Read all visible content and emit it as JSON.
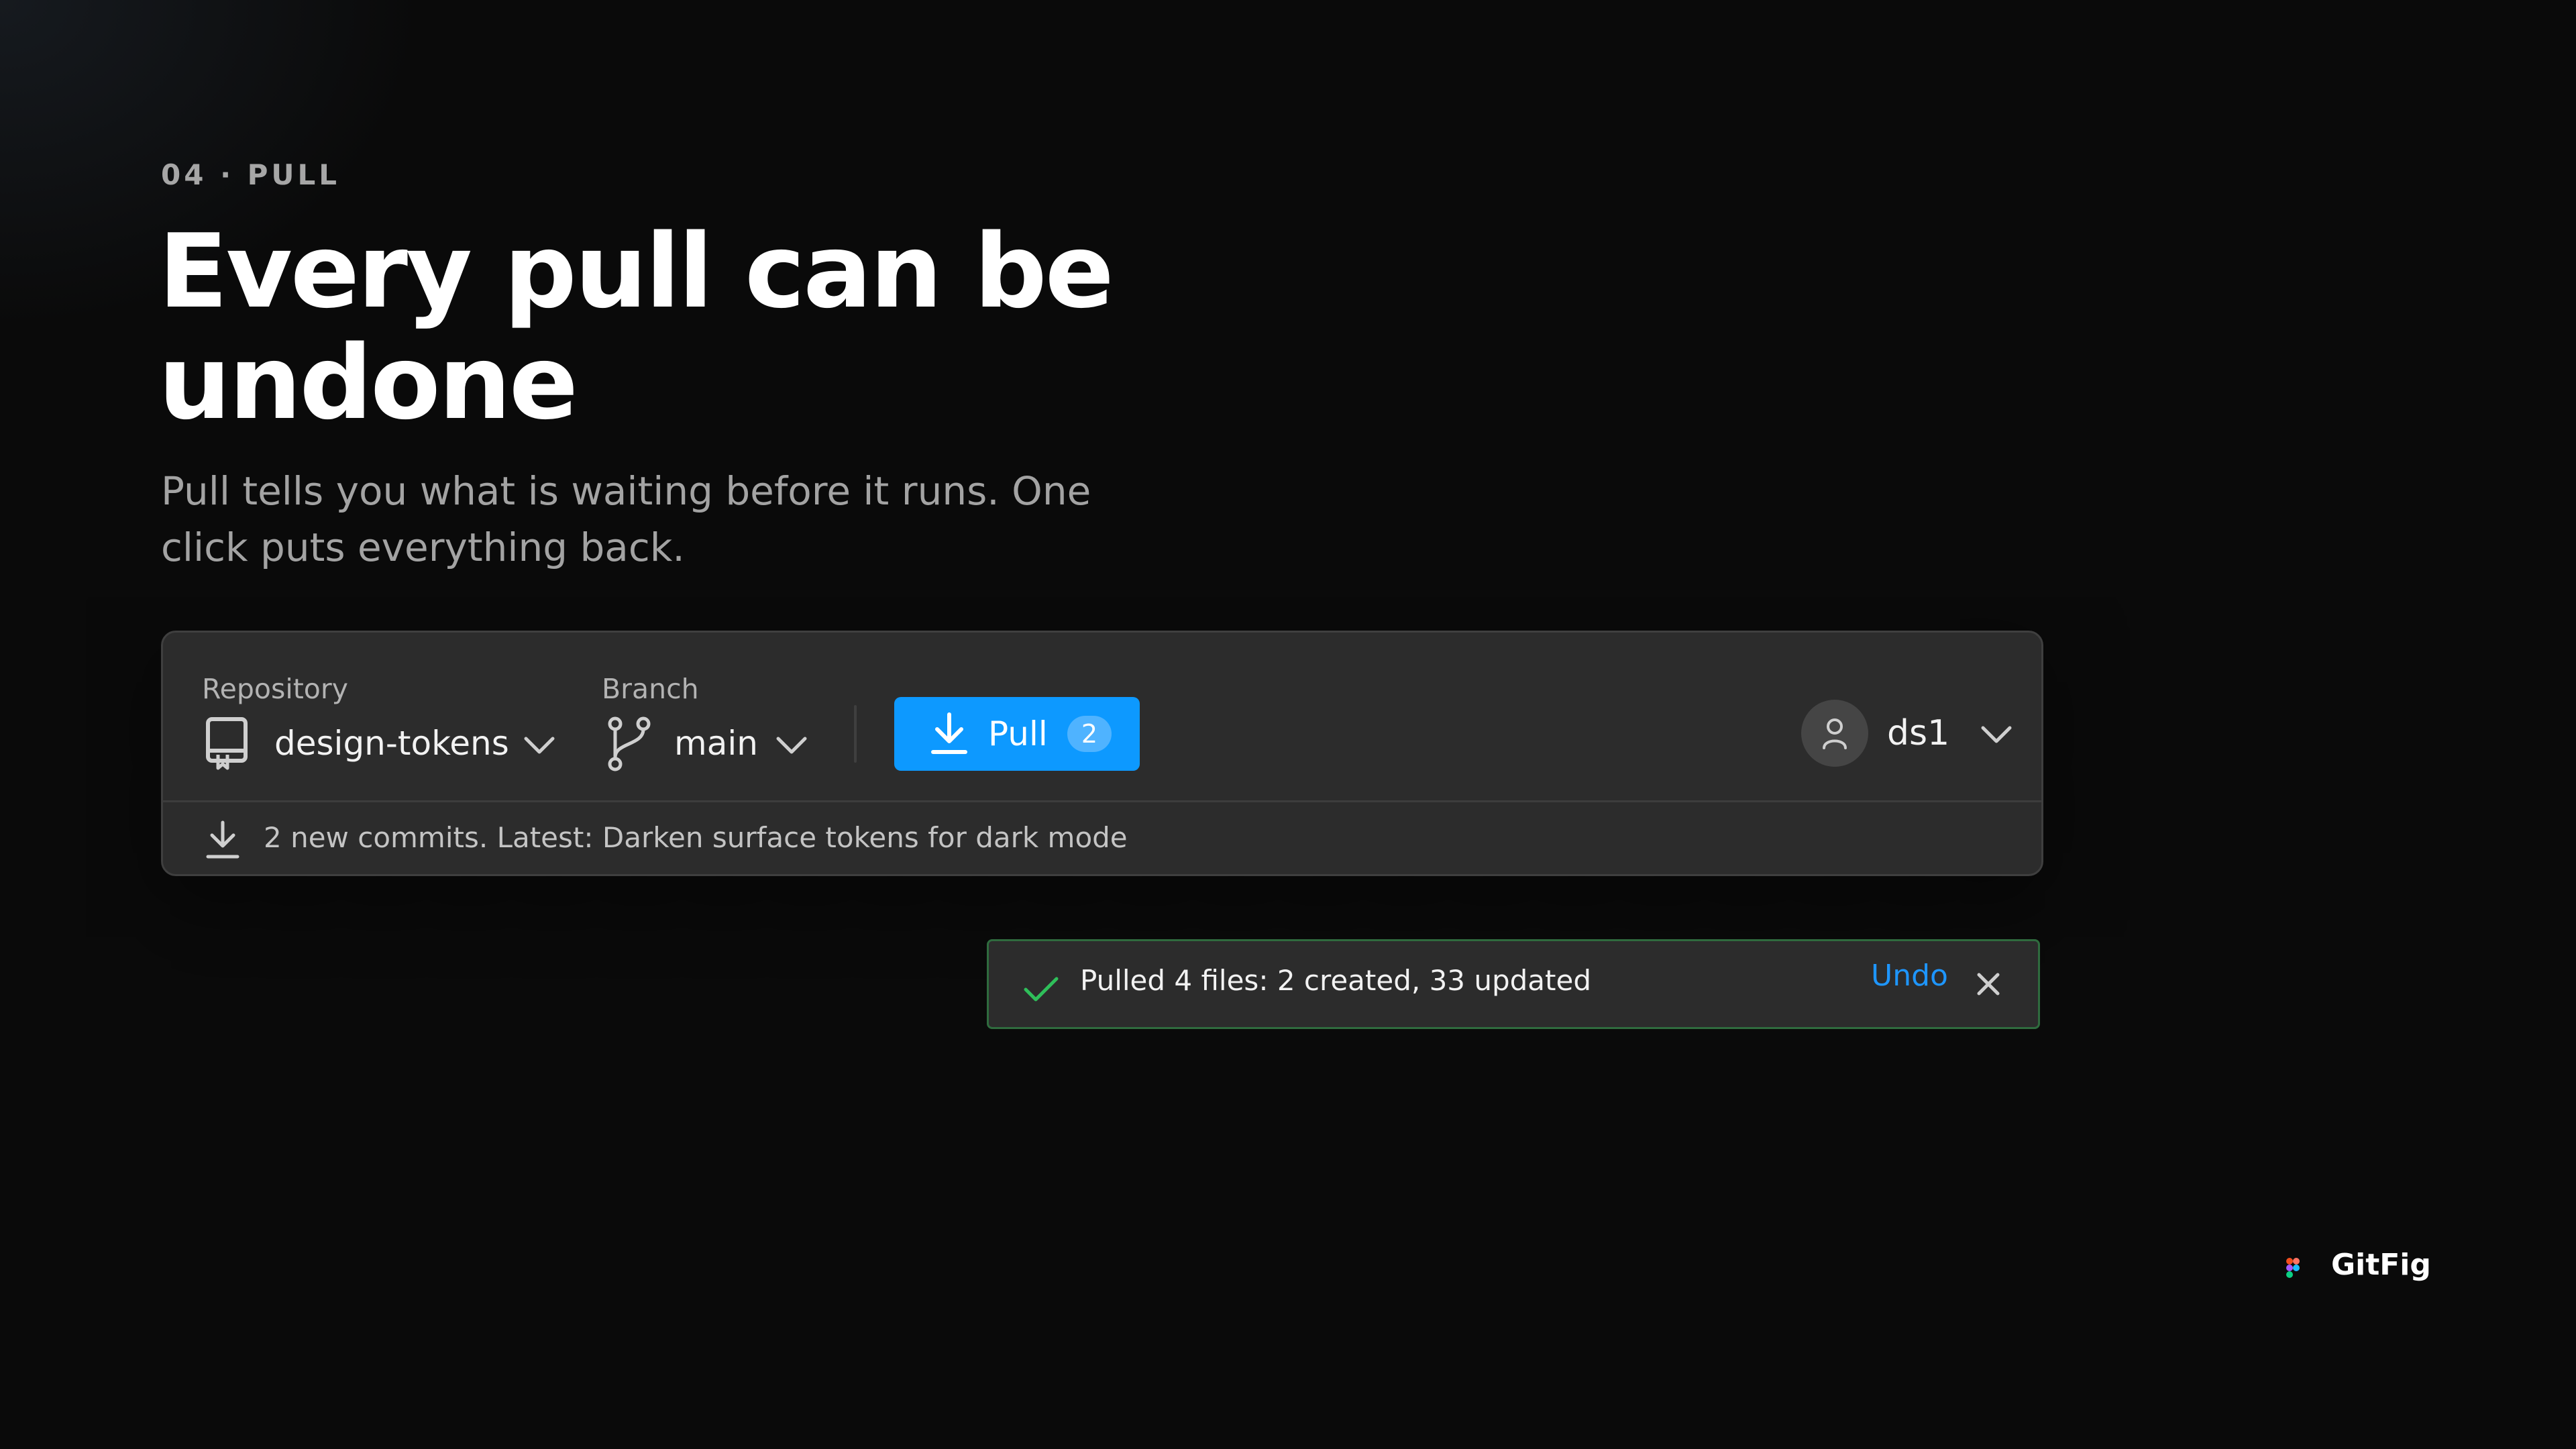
{
  "section": {
    "eyebrow": "04 · PULL"
  },
  "hero": {
    "headline": "Every pull can be undone",
    "subtitle": "Pull tells you what is waiting before it runs. One click puts everything back."
  },
  "panel": {
    "repository": {
      "label": "Repository",
      "value": "design-tokens",
      "icon": "repo-icon"
    },
    "branch": {
      "label": "Branch",
      "value": "main",
      "icon": "branch-icon"
    },
    "pull_button": {
      "label": "Pull",
      "badge": "2",
      "icon": "download-icon"
    },
    "account": {
      "name": "ds1",
      "icon": "user-icon"
    },
    "status": {
      "text": "2 new commits. Latest: Darken surface tokens for dark mode",
      "icon": "download-icon"
    }
  },
  "toast": {
    "message": "Pulled 4 files: 2 created, 33 updated",
    "action": "Undo",
    "success_color": "#2fbf5a",
    "icons": [
      "check-icon",
      "close-icon"
    ]
  },
  "brand": {
    "name": "GitFig",
    "icon": "figma-logo-icon"
  },
  "colors": {
    "background": "#0a0a0a",
    "panel": "#2c2c2c",
    "accent": "#0d99ff",
    "link": "#1e96ff",
    "toast_border": "#2f6b3e"
  }
}
